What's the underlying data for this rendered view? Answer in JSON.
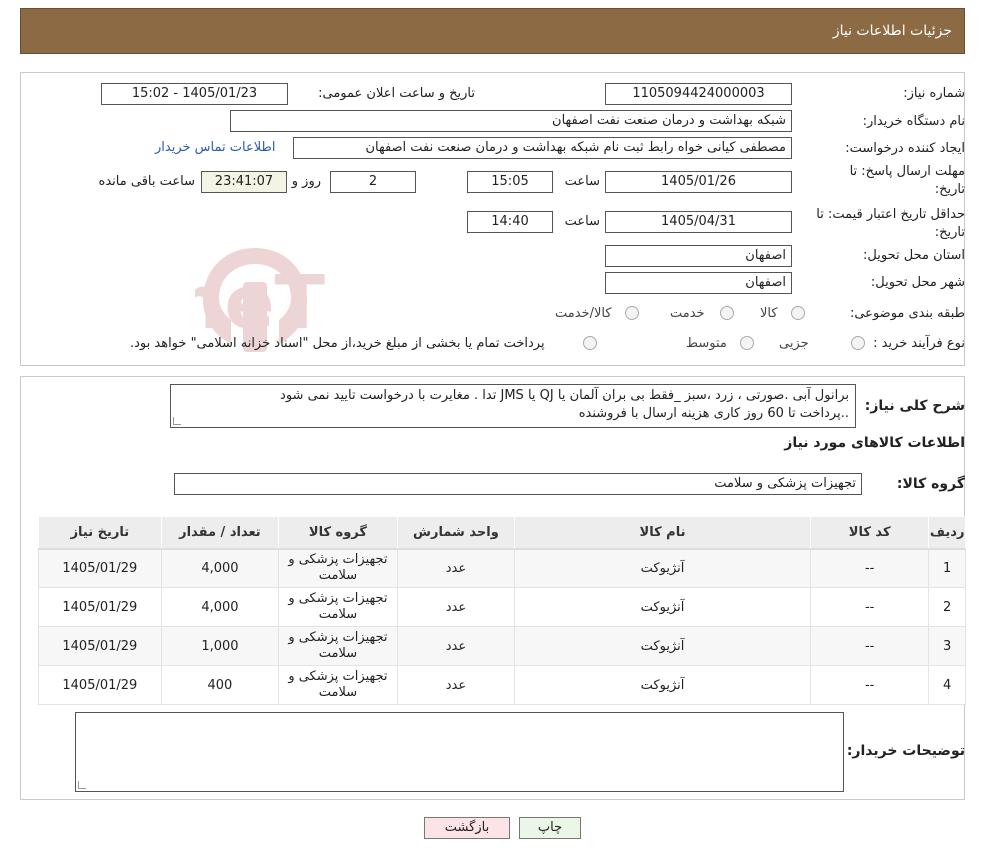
{
  "header": {
    "title": "جزئیات اطلاعات نیاز"
  },
  "form": {
    "need_number_label": "شماره نیاز:",
    "need_number": "1105094424000003",
    "announce_label": "تاریخ و ساعت اعلان عمومی:",
    "announce_value": "1405/01/23 - 15:02",
    "buyer_org_label": "نام دستگاه خریدار:",
    "buyer_org": "شبکه بهداشت و درمان صنعت نفت اصفهان",
    "requester_label": "ایجاد کننده درخواست:",
    "requester": "مصطفی کیانی خواه رابط ثبت نام شبکه بهداشت و درمان صنعت نفت اصفهان",
    "contact_link": "اطلاعات تماس خریدار",
    "deadline_label_1": "مهلت ارسال پاسخ: تا",
    "deadline_label_2": "تاریخ:",
    "deadline_date": "1405/01/26",
    "time_label": "ساعت",
    "deadline_time": "15:05",
    "days_value": "2",
    "days_label": "روز و",
    "remaining_time": "23:41:07",
    "remaining_label": "ساعت باقی مانده",
    "validity_label_1": "حداقل تاریخ اعتبار قیمت: تا",
    "validity_label_2": "تاریخ:",
    "validity_date": "1405/04/31",
    "validity_time": "14:40",
    "province_label": "استان محل تحویل:",
    "province": "اصفهان",
    "city_label": "شهر محل تحویل:",
    "city": "اصفهان",
    "category_label": "طبقه بندی موضوعی:",
    "category_options": [
      "کالا",
      "خدمت",
      "کالا/خدمت"
    ],
    "process_label": "نوع فرآیند خرید :",
    "process_options": [
      "جزیی",
      "متوسط"
    ],
    "process_note": "پرداخت تمام یا بخشی از مبلغ خرید،از محل \"اسناد خزانه اسلامی\" خواهد بود."
  },
  "description": {
    "label": "شرح کلی نیاز:",
    "line1": "برانول آبی .صورتی ، زرد ،سبز _فقط  بی بران آلمان یا QJ یا JMS   تدا . مغایرت با درخواست تایید نمی شود",
    "line2": "..پرداخت تا 60 روز کاری هزینه ارسال با فروشنده"
  },
  "goods": {
    "section_title": "اطلاعات کالاهای مورد نیاز",
    "group_label": "گروه کالا:",
    "group_value": "تجهیزات پزشکی و سلامت",
    "columns": [
      "ردیف",
      "کد کالا",
      "نام کالا",
      "واحد شمارش",
      "گروه کالا",
      "تعداد / مقدار",
      "تاریخ نیاز"
    ],
    "rows": [
      {
        "row": "1",
        "code": "--",
        "name": "آنژیوکت",
        "unit": "عدد",
        "group": "تجهیزات پزشکی و سلامت",
        "qty": "4,000",
        "date": "1405/01/29"
      },
      {
        "row": "2",
        "code": "--",
        "name": "آنژیوکت",
        "unit": "عدد",
        "group": "تجهیزات پزشکی و سلامت",
        "qty": "4,000",
        "date": "1405/01/29"
      },
      {
        "row": "3",
        "code": "--",
        "name": "آنژیوکت",
        "unit": "عدد",
        "group": "تجهیزات پزشکی و سلامت",
        "qty": "1,000",
        "date": "1405/01/29"
      },
      {
        "row": "4",
        "code": "--",
        "name": "آنژیوکت",
        "unit": "عدد",
        "group": "تجهیزات پزشکی و سلامت",
        "qty": "400",
        "date": "1405/01/29"
      }
    ]
  },
  "notes": {
    "label": "توضیحات خریدار:",
    "value": ""
  },
  "buttons": {
    "print": "چاپ",
    "back": "بازگشت"
  },
  "colors": {
    "header_bg": "#8b6a44",
    "link": "#2a5db0",
    "print_bg": "#eaf6e6",
    "back_bg": "#fbe3e6"
  },
  "watermark": {
    "text": "AriaTender.neT"
  }
}
